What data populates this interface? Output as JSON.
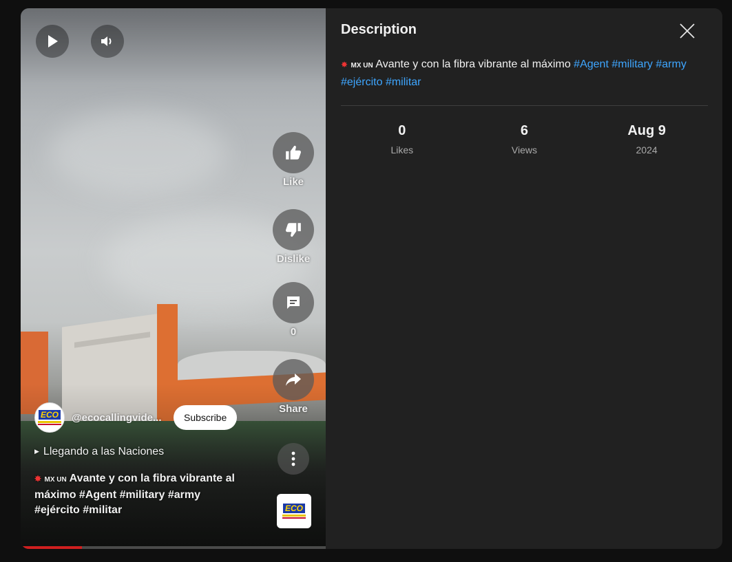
{
  "video": {
    "controls": {
      "play_icon": "play-icon",
      "volume_icon": "volume-icon"
    },
    "actions": {
      "like_label": "Like",
      "dislike_label": "Dislike",
      "comments_count": "0",
      "share_label": "Share"
    },
    "channel": {
      "handle": "@ecocallingvide...",
      "subscribe_label": "Subscribe",
      "logo_text": "ECO"
    },
    "playlist_label": "Llegando a las Naciones",
    "title": {
      "prefix_flags": "MX UN",
      "text": "Avante y con la fibra vibrante al máximo #Agent #military #army #ejército #militar"
    },
    "progress_fraction": 0.2
  },
  "description_panel": {
    "title": "Description",
    "body": {
      "prefix_flags": "MX UN",
      "text": "Avante y con la fibra vibrante al máximo",
      "hashtags": [
        "#Agent",
        "#military",
        "#army",
        "#ejército",
        "#militar"
      ]
    },
    "stats": [
      {
        "value": "0",
        "label": "Likes"
      },
      {
        "value": "6",
        "label": "Views"
      },
      {
        "value": "Aug 9",
        "label": "2024"
      }
    ]
  },
  "colors": {
    "accent_link": "#3ea6ff",
    "progress": "#d01f1f",
    "panel_bg": "#212121"
  }
}
